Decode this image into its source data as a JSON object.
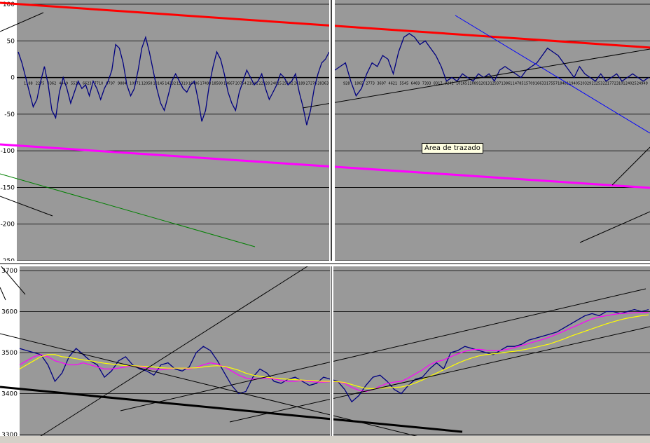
{
  "tooltip": "Área de trazado",
  "chart_data": [
    {
      "type": "line",
      "title": "",
      "ylim": [
        -250,
        100
      ],
      "yticks": [
        100,
        50,
        0,
        -50,
        -100,
        -150,
        -200,
        -250
      ],
      "grid": true,
      "xtick_labels_left": [
        "1188",
        "2275",
        "3362",
        "4449",
        "5536",
        "6623",
        "7710",
        "8797",
        "9884",
        "10971",
        "12058",
        "13145",
        "14232",
        "15319",
        "16406",
        "17493",
        "18580",
        "19667",
        "20754",
        "21841",
        "22928",
        "24015",
        "25102",
        "26189",
        "27276",
        "28363"
      ],
      "xtick_labels_right": [
        "928",
        "1865",
        "2773",
        "3697",
        "4621",
        "5545",
        "6469",
        "7393",
        "8317",
        "9241",
        "10165",
        "11089",
        "12013",
        "12937",
        "13861",
        "14785",
        "15709",
        "16633",
        "17557",
        "18481",
        "19405",
        "20329",
        "21253",
        "22177",
        "23101",
        "24025",
        "24949"
      ],
      "series": [
        {
          "color": "#000080",
          "left_values": [
            35,
            20,
            0,
            -20,
            -40,
            -30,
            -5,
            15,
            -10,
            -45,
            -55,
            -20,
            0,
            -15,
            -35,
            -20,
            -5,
            -15,
            -10,
            -25,
            -5,
            -15,
            -30,
            -15,
            -5,
            10,
            45,
            40,
            20,
            -10,
            -25,
            -15,
            10,
            40,
            55,
            35,
            10,
            -15,
            -35,
            -45,
            -25,
            -5,
            5,
            -5,
            -15,
            -20,
            -10,
            -5,
            -30,
            -60,
            -45,
            -10,
            15,
            35,
            25,
            5,
            -20,
            -35,
            -45,
            -20,
            -5,
            10,
            0,
            -10,
            -5,
            5,
            -15,
            -30,
            -20,
            -10,
            5,
            0,
            -10,
            -5,
            5,
            -20,
            -40,
            -65,
            -45,
            -15,
            5,
            20,
            25,
            35
          ],
          "right_values": [
            10,
            15,
            20,
            -5,
            -25,
            -15,
            5,
            20,
            15,
            30,
            25,
            5,
            35,
            55,
            60,
            55,
            45,
            50,
            40,
            30,
            15,
            -5,
            0,
            -5,
            5,
            0,
            -5,
            5,
            0,
            5,
            -5,
            10,
            15,
            10,
            5,
            0,
            10,
            15,
            20,
            30,
            40,
            35,
            30,
            20,
            10,
            0,
            15,
            5,
            0,
            -5,
            5,
            -5,
            0,
            5,
            -5,
            0,
            5,
            0,
            -5,
            0
          ]
        },
        {
          "color": "#ff0000",
          "name_line": "trend",
          "left_values": [],
          "right_values": []
        }
      ]
    },
    {
      "type": "line",
      "title": "",
      "ylim": [
        3300,
        3700
      ],
      "yticks": [
        3700,
        3600,
        3500,
        3400,
        3300
      ],
      "grid": true,
      "series": [
        {
          "color": "#000080",
          "values": [
            3510,
            3505,
            3500,
            3495,
            3470,
            3430,
            3450,
            3490,
            3510,
            3495,
            3480,
            3470,
            3440,
            3455,
            3480,
            3490,
            3470,
            3460,
            3455,
            3445,
            3470,
            3475,
            3460,
            3455,
            3465,
            3500,
            3515,
            3505,
            3480,
            3450,
            3420,
            3400,
            3405,
            3440,
            3460,
            3450,
            3430,
            3425,
            3435,
            3440,
            3430,
            3420,
            3425,
            3440,
            3435,
            3430,
            3410,
            3380,
            3395,
            3420,
            3440,
            3445,
            3430,
            3410,
            3400,
            3420,
            3435,
            3440,
            3460,
            3475,
            3460,
            3500,
            3505,
            3515,
            3510,
            3505,
            3500,
            3495,
            3505,
            3515,
            3515,
            3520,
            3530,
            3535,
            3540,
            3545,
            3550,
            3560,
            3570,
            3580,
            3590,
            3595,
            3590,
            3600,
            3600,
            3595,
            3600,
            3605,
            3600,
            3605
          ]
        },
        {
          "color": "#ff00ff",
          "values": [
            3470,
            3480,
            3490,
            3495,
            3490,
            3480,
            3475,
            3470,
            3470,
            3475,
            3470,
            3465,
            3460,
            3460,
            3462,
            3465,
            3468,
            3466,
            3462,
            3460,
            3458,
            3460,
            3462,
            3462,
            3460,
            3464,
            3470,
            3475,
            3472,
            3465,
            3455,
            3445,
            3438,
            3435,
            3437,
            3438,
            3436,
            3432,
            3430,
            3430,
            3432,
            3430,
            3428,
            3428,
            3429,
            3429,
            3425,
            3415,
            3408,
            3405,
            3410,
            3418,
            3425,
            3428,
            3430,
            3438,
            3448,
            3458,
            3470,
            3478,
            3482,
            3490,
            3497,
            3503,
            3507,
            3508,
            3506,
            3505,
            3505,
            3508,
            3512,
            3517,
            3522,
            3527,
            3532,
            3538,
            3545,
            3552,
            3560,
            3567,
            3575,
            3582,
            3587,
            3590,
            3593,
            3595,
            3596,
            3597,
            3598,
            3598
          ]
        },
        {
          "color": "#ffff00",
          "values": [
            3460,
            3470,
            3480,
            3490,
            3495,
            3495,
            3490,
            3488,
            3485,
            3482,
            3480,
            3477,
            3474,
            3472,
            3470,
            3468,
            3468,
            3467,
            3466,
            3465,
            3463,
            3462,
            3462,
            3462,
            3462,
            3463,
            3465,
            3467,
            3468,
            3466,
            3462,
            3457,
            3450,
            3445,
            3442,
            3440,
            3438,
            3436,
            3435,
            3434,
            3433,
            3432,
            3431,
            3430,
            3430,
            3429,
            3427,
            3422,
            3417,
            3413,
            3412,
            3413,
            3414,
            3415,
            3416,
            3420,
            3426,
            3433,
            3442,
            3450,
            3458,
            3466,
            3474,
            3481,
            3487,
            3492,
            3495,
            3497,
            3499,
            3501,
            3503,
            3506,
            3509,
            3513,
            3517,
            3521,
            3527,
            3533,
            3540,
            3546,
            3552,
            3558,
            3564,
            3570,
            3575,
            3580,
            3584,
            3587,
            3590,
            3592
          ]
        }
      ]
    }
  ]
}
